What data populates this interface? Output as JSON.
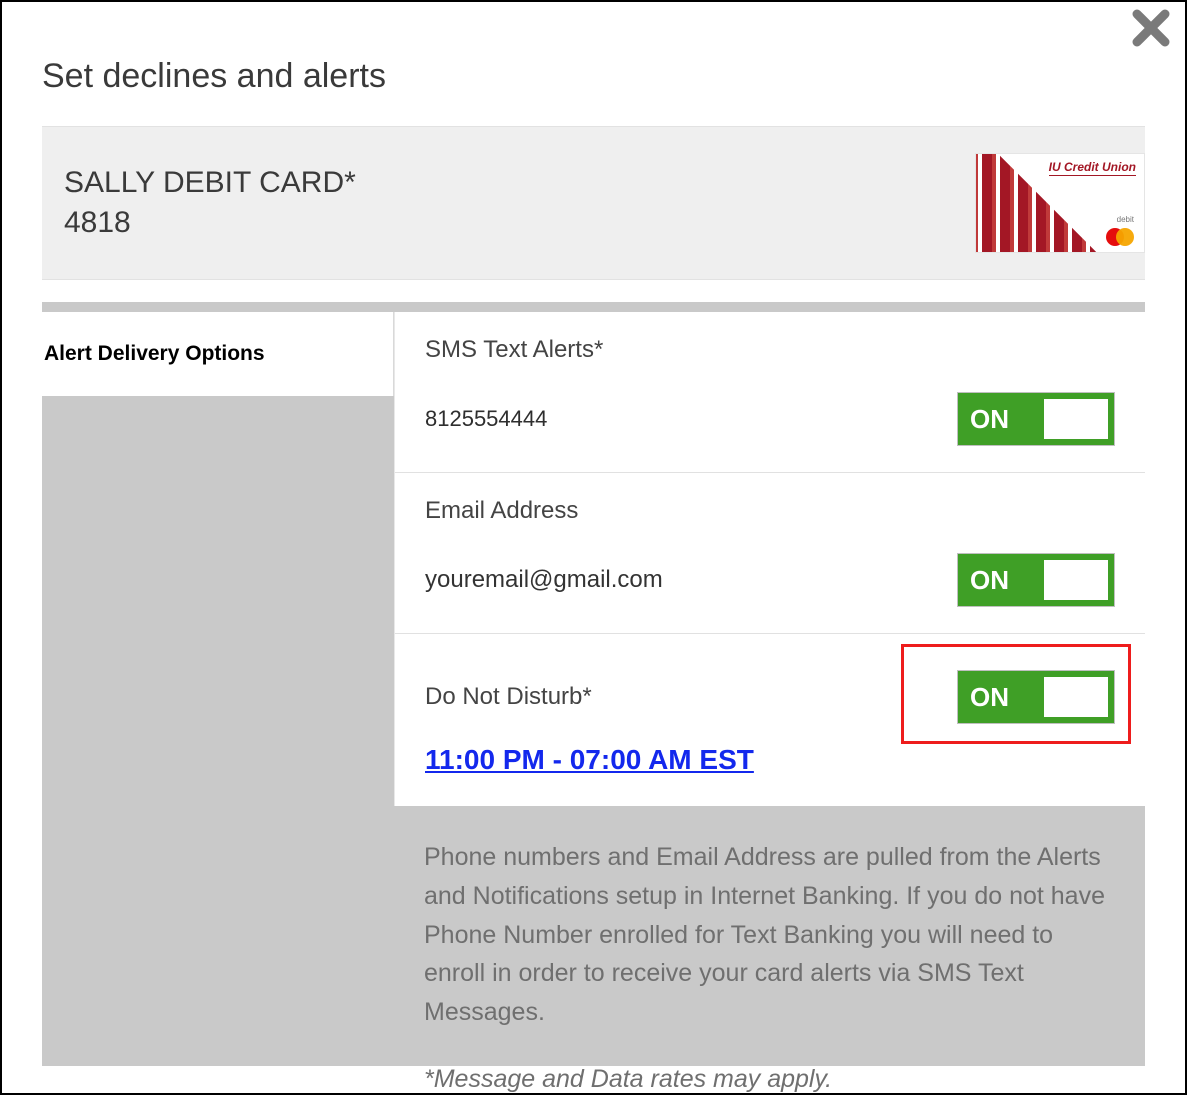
{
  "modal": {
    "title": "Set declines and alerts"
  },
  "card": {
    "name_line1": "SALLY DEBIT CARD*",
    "name_line2": "4818",
    "art_brand": "IU Credit Union",
    "art_sublabel": "debit"
  },
  "sidebar": {
    "tab_label": "Alert Delivery Options"
  },
  "sections": {
    "sms": {
      "label": "SMS Text Alerts*",
      "value": "8125554444",
      "toggle": "ON"
    },
    "email": {
      "label": "Email Address",
      "value": "youremail@gmail.com",
      "toggle": "ON"
    },
    "dnd": {
      "label": "Do Not Disturb*",
      "time_range": "11:00 PM - 07:00 AM EST",
      "toggle": "ON"
    }
  },
  "notes": {
    "body": "Phone numbers and Email Address are pulled from the Alerts and Notifications setup in Internet Banking. If you do not have Phone Number enrolled for Text Banking you will need to enroll in order to receive your card alerts via SMS Text Messages.",
    "fineprint": "*Message and Data rates may apply."
  }
}
